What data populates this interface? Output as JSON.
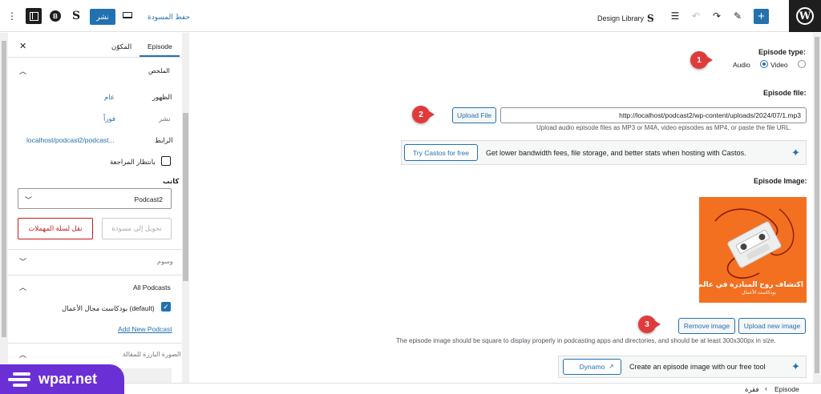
{
  "toolbar": {
    "publish_label": "نشر",
    "save_draft_label": "حفظ المسودة",
    "design_library_label": "Design Library"
  },
  "sidebar": {
    "tab_episode": "Episode",
    "tab_block": "المكوّن",
    "summary_title": "الملخص",
    "visibility_label": "الظهور",
    "visibility_value": "عام",
    "publish_label": "نشر",
    "publish_value": "فوراً",
    "link_label": "الرابط",
    "link_value": "localhost/podcast2/podcast...",
    "pending_review_label": "بانتظار المراجعة",
    "author_label": "كاتب",
    "author_value": "Podcast2",
    "switch_draft_label": "تحويل إلى مسودة",
    "move_trash_label": "نقل لسلة المهملات",
    "tags_label": "وسوم",
    "podcasts_title": "All Podcasts",
    "podcast_item_label": "بودكاست مجال الأعمال (default)",
    "add_podcast_label": "Add New Podcast",
    "featured_image_label": "الصورة البارزة للمقالة"
  },
  "main": {
    "episode_type_label": "Episode type:",
    "audio_label": "Audio",
    "video_label": "Video",
    "selected_type": "Audio",
    "episode_file_label": "Episode file:",
    "file_url": "http://localhost/podcast2/wp-content/uploads/2024/07/1.mp3",
    "upload_file_label": "Upload File",
    "file_help": "Upload audio episode files as MP3 or M4A, video episodes as MP4, or paste the file URL.",
    "castos_text": "Get lower bandwidth fees, file storage, and better stats when hosting with Castos.",
    "castos_button": "Try Castos for free",
    "episode_image_label": "Episode Image:",
    "image_caption": "اكتشاف روح المبادرة في عالم الأعمال",
    "image_subcaption": "بودكاست الأعمال",
    "remove_image_label": "Remove image",
    "upload_image_label": "Upload new image",
    "image_help": "The episode image should be square to display properly in podcasting apps and directories, and should be at least 300x300px in size.",
    "dynamo_text": "Create an episode image with our free tool",
    "dynamo_button": "Dynamo"
  },
  "markers": [
    "1",
    "2",
    "3"
  ],
  "breadcrumb": {
    "item1": "Episode",
    "item2": "فقرة"
  },
  "watermark": "wpar.net",
  "colors": {
    "accent": "#2271b1",
    "marker": "#e03b3b",
    "image_bg": "#f37021",
    "logo_bg": "#6b2fd6"
  }
}
